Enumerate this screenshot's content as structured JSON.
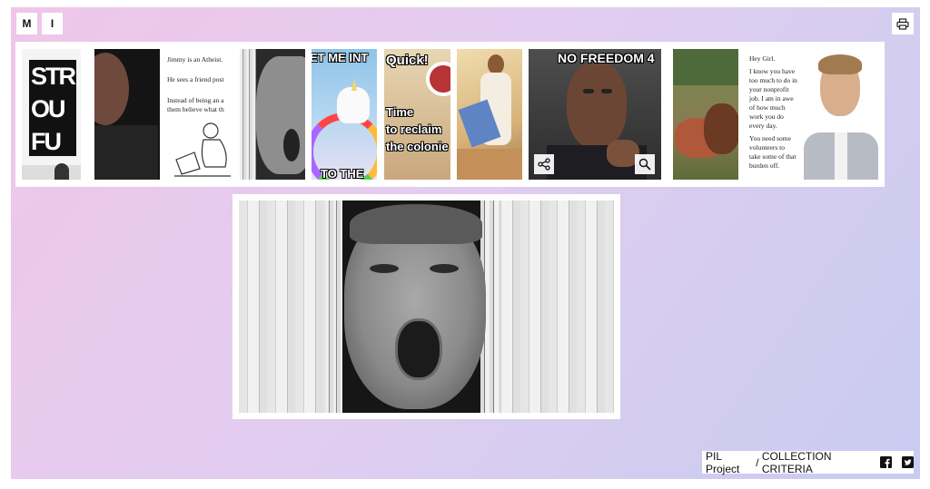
{
  "toolbar": {
    "m_label": "M",
    "i_label": "I",
    "print_icon": "printer-icon"
  },
  "strip": {
    "thumbs": [
      {
        "name": "thumb-poster",
        "text": "STRA OU FU"
      },
      {
        "name": "thumb-man-dark",
        "text": ""
      },
      {
        "name": "thumb-atheist",
        "lines": [
          "Jimmy is an Atheist.",
          "He sees a friend post",
          "Instead of being an a",
          "them believe what th"
        ]
      },
      {
        "name": "thumb-trump-door",
        "text": ""
      },
      {
        "name": "thumb-unicorn",
        "top": "ET ME INT",
        "bottom": "TO THE"
      },
      {
        "name": "thumb-quick",
        "top": "Quick!",
        "bottom1": "Time",
        "bottom2": "to reclaim",
        "bottom3": "the colonie"
      },
      {
        "name": "thumb-jesus",
        "text": ""
      },
      {
        "name": "thumb-no-freedom",
        "top": "NO FREEDOM 4"
      },
      {
        "name": "thumb-horse-man",
        "text": ""
      },
      {
        "name": "thumb-hey-girl",
        "lines": [
          "Hey Girl.",
          "I know you have",
          "too much to do in",
          "your nonprofit",
          "job. I am in awe",
          "of how much",
          "work you do",
          "every day.",
          "You need some",
          "volunteers to",
          "take some of that",
          "burden off."
        ]
      }
    ],
    "share_icon": "share-icon",
    "zoom_icon": "magnifier-icon"
  },
  "footer": {
    "project_label": "PIL Project",
    "separator": " / ",
    "criteria_label": "COLLECTION CRITERIA",
    "facebook_icon": "facebook-icon",
    "twitter_icon": "twitter-icon"
  }
}
